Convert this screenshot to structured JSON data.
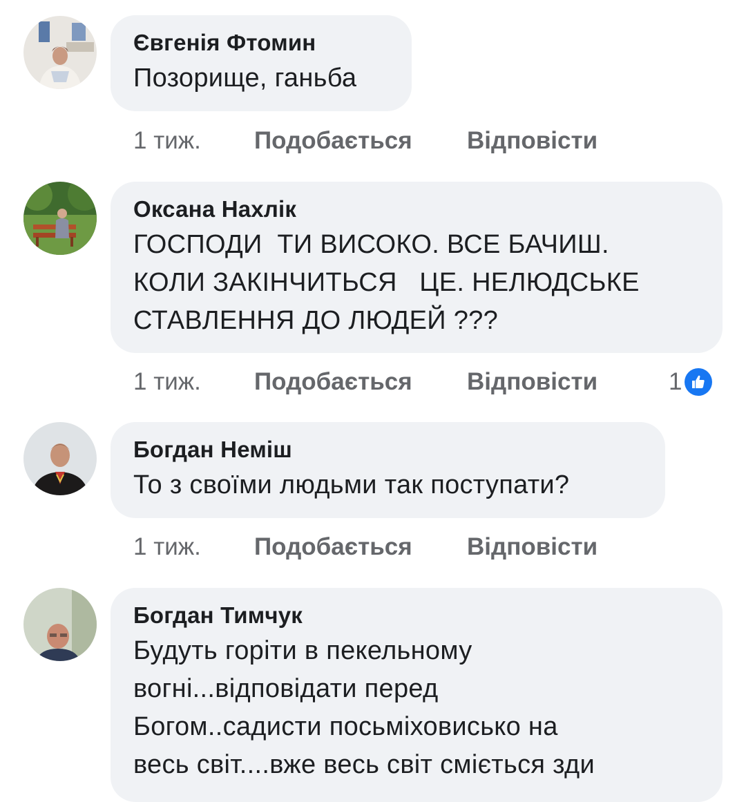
{
  "comments": [
    {
      "author": "Євгенія Фтомин",
      "text": "Позорище, ганьба",
      "time": "1 тиж.",
      "like_label": "Подобається",
      "reply_label": "Відповісти"
    },
    {
      "author": "Оксана Нахлік",
      "text": "ГОСПОДИ  ТИ ВИСОКО. ВСЕ БАЧИШ.\nКОЛИ ЗАКІНЧИТЬСЯ   ЦЕ. НЕЛЮДСЬКЕ\nСТАВЛЕННЯ ДО ЛЮДЕЙ ???",
      "time": "1 тиж.",
      "like_label": "Подобається",
      "reply_label": "Відповісти",
      "reaction_count": "1",
      "reaction_icon": "like-icon",
      "reaction_color": "#1877f2"
    },
    {
      "author": "Богдан Неміш",
      "text": "То з своїми людьми так поступати?",
      "time": "1 тиж.",
      "like_label": "Подобається",
      "reply_label": "Відповісти"
    },
    {
      "author": "Богдан Тимчук",
      "text": "Будуть горіти в пекельному\nвогні...відповідати перед\nБогом..садисти посьміховисько на\nвесь світ....вже весь світ сміється зди"
    }
  ],
  "colors": {
    "bubble_background": "#f0f2f5",
    "meta_text": "#65676b",
    "accent": "#1877f2"
  }
}
